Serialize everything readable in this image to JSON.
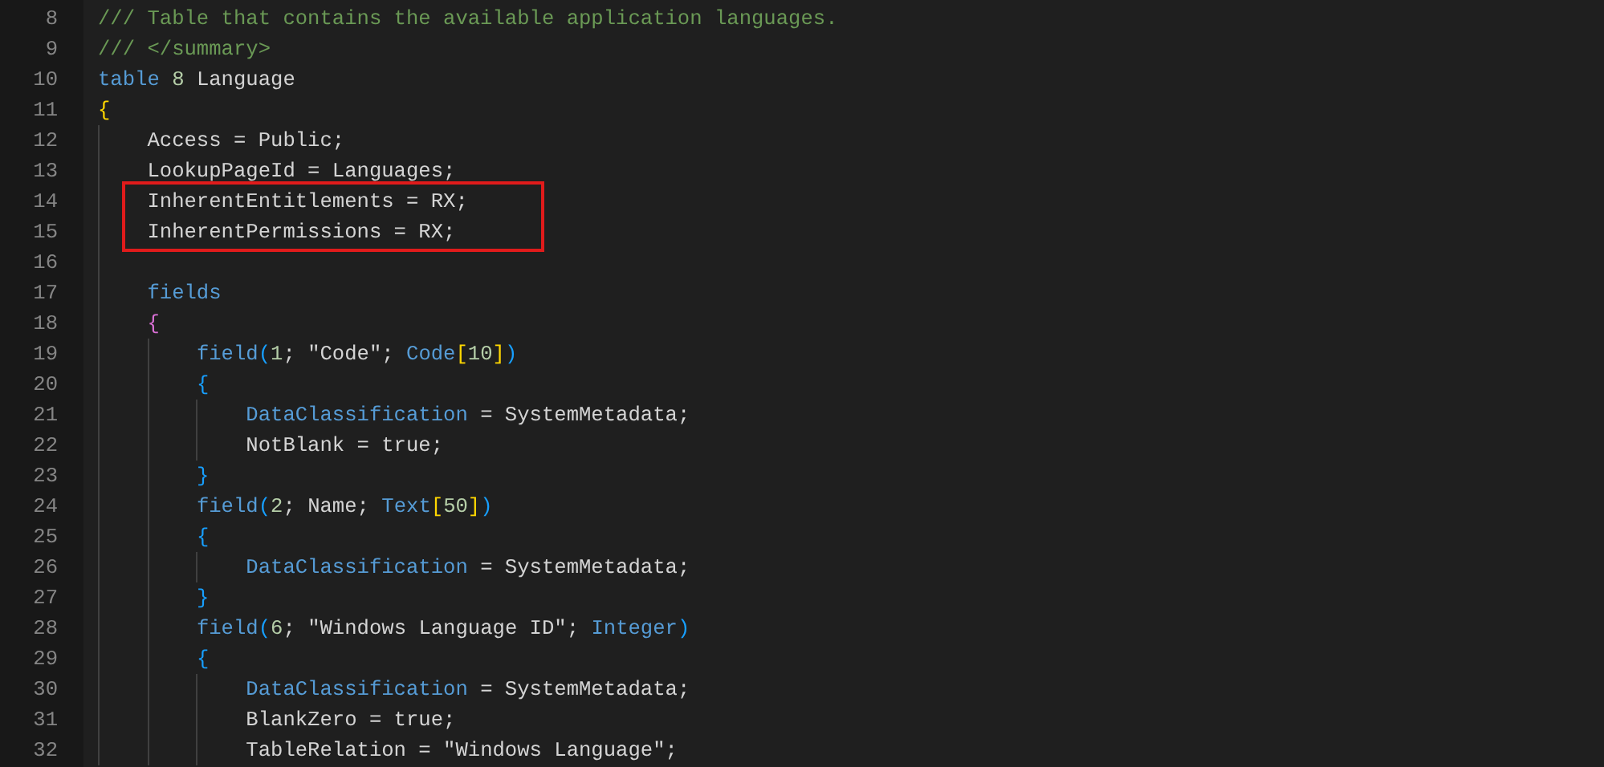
{
  "editor": {
    "lines": [
      {
        "kind": "line",
        "number": "8",
        "tokens": [
          {
            "text": "/// Table that contains the available application languages.",
            "kind": "comment"
          }
        ]
      },
      {
        "kind": "line",
        "number": "9",
        "tokens": [
          {
            "text": "/// </summary>",
            "kind": "comment"
          }
        ]
      },
      {
        "kind": "line",
        "number": "10",
        "tokens": [
          {
            "text": "table ",
            "kind": "keyword"
          },
          {
            "text": "8",
            "kind": "number"
          },
          {
            "text": " Language",
            "kind": "plain"
          }
        ]
      },
      {
        "kind": "line",
        "number": "11",
        "tokens": [
          {
            "text": "{",
            "kind": "bracket1"
          }
        ],
        "children": [
          {
            "kind": "line",
            "number": "12",
            "tokens": [
              {
                "text": "Access = Public;",
                "kind": "plain"
              }
            ]
          },
          {
            "kind": "line",
            "number": "13",
            "tokens": [
              {
                "text": "LookupPageId = Languages;",
                "kind": "plain"
              }
            ]
          },
          {
            "kind": "callout",
            "lines": [
              {
                "kind": "line",
                "number": "14",
                "tokens": [
                  {
                    "text": "InherentEntitlements = RX;",
                    "kind": "plain"
                  }
                ]
              },
              {
                "kind": "line",
                "number": "15",
                "tokens": [
                  {
                    "text": "InherentPermissions = RX;",
                    "kind": "plain"
                  }
                ]
              }
            ]
          },
          {
            "kind": "line",
            "number": "16"
          },
          {
            "kind": "line",
            "number": "17",
            "tokens": [
              {
                "text": "fields",
                "kind": "keyword"
              }
            ]
          },
          {
            "kind": "line",
            "number": "18",
            "tokens": [
              {
                "text": "{",
                "kind": "bracket2"
              }
            ],
            "children": [
              {
                "kind": "line",
                "number": "19",
                "tokens": [
                  {
                    "text": "field",
                    "kind": "keyword"
                  },
                  {
                    "text": "(",
                    "kind": "bracket3"
                  },
                  {
                    "text": "1",
                    "kind": "number"
                  },
                  {
                    "text": "; \"Code\"; ",
                    "kind": "plain"
                  },
                  {
                    "text": "Code",
                    "kind": "keyword"
                  },
                  {
                    "text": "[",
                    "kind": "bracket1"
                  },
                  {
                    "text": "10",
                    "kind": "number"
                  },
                  {
                    "text": "]",
                    "kind": "bracket1"
                  },
                  {
                    "text": ")",
                    "kind": "bracket3"
                  }
                ]
              },
              {
                "kind": "line",
                "number": "20",
                "tokens": [
                  {
                    "text": "{",
                    "kind": "bracket3"
                  }
                ],
                "children": [
                  {
                    "kind": "line",
                    "number": "21",
                    "tokens": [
                      {
                        "text": "DataClassification",
                        "kind": "property"
                      },
                      {
                        "text": " = SystemMetadata;",
                        "kind": "plain"
                      }
                    ]
                  },
                  {
                    "kind": "line",
                    "number": "22",
                    "tokens": [
                      {
                        "text": "NotBlank = true;",
                        "kind": "plain"
                      }
                    ]
                  }
                ]
              },
              {
                "kind": "line",
                "number": "23",
                "tokens": [
                  {
                    "text": "}",
                    "kind": "bracket3"
                  }
                ]
              },
              {
                "kind": "line",
                "number": "24",
                "tokens": [
                  {
                    "text": "field",
                    "kind": "keyword"
                  },
                  {
                    "text": "(",
                    "kind": "bracket3"
                  },
                  {
                    "text": "2",
                    "kind": "number"
                  },
                  {
                    "text": "; Name; ",
                    "kind": "plain"
                  },
                  {
                    "text": "Text",
                    "kind": "keyword"
                  },
                  {
                    "text": "[",
                    "kind": "bracket1"
                  },
                  {
                    "text": "50",
                    "kind": "number"
                  },
                  {
                    "text": "]",
                    "kind": "bracket1"
                  },
                  {
                    "text": ")",
                    "kind": "bracket3"
                  }
                ]
              },
              {
                "kind": "line",
                "number": "25",
                "tokens": [
                  {
                    "text": "{",
                    "kind": "bracket3"
                  }
                ],
                "children": [
                  {
                    "kind": "line",
                    "number": "26",
                    "tokens": [
                      {
                        "text": "DataClassification",
                        "kind": "property"
                      },
                      {
                        "text": " = SystemMetadata;",
                        "kind": "plain"
                      }
                    ]
                  }
                ]
              },
              {
                "kind": "line",
                "number": "27",
                "tokens": [
                  {
                    "text": "}",
                    "kind": "bracket3"
                  }
                ]
              },
              {
                "kind": "line",
                "number": "28",
                "tokens": [
                  {
                    "text": "field",
                    "kind": "keyword"
                  },
                  {
                    "text": "(",
                    "kind": "bracket3"
                  },
                  {
                    "text": "6",
                    "kind": "number"
                  },
                  {
                    "text": "; \"Windows Language ID\"; ",
                    "kind": "plain"
                  },
                  {
                    "text": "Integer",
                    "kind": "keyword"
                  },
                  {
                    "text": ")",
                    "kind": "bracket3"
                  }
                ]
              },
              {
                "kind": "line",
                "number": "29",
                "tokens": [
                  {
                    "text": "{",
                    "kind": "bracket3"
                  }
                ],
                "children": [
                  {
                    "kind": "line",
                    "number": "30",
                    "tokens": [
                      {
                        "text": "DataClassification",
                        "kind": "property"
                      },
                      {
                        "text": " = SystemMetadata;",
                        "kind": "plain"
                      }
                    ]
                  },
                  {
                    "kind": "line",
                    "number": "31",
                    "tokens": [
                      {
                        "text": "BlankZero = true;",
                        "kind": "plain"
                      }
                    ]
                  },
                  {
                    "kind": "line",
                    "number": "32",
                    "tokens": [
                      {
                        "text": "TableRelation = \"Windows Language\";",
                        "kind": "plain"
                      }
                    ]
                  }
                ]
              }
            ]
          }
        ]
      }
    ]
  }
}
